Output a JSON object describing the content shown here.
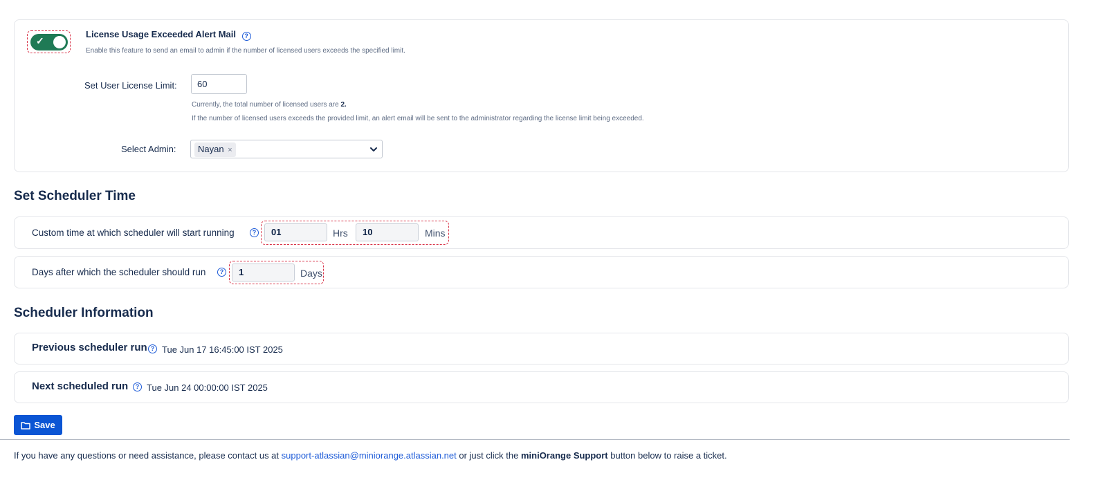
{
  "alert_mail": {
    "title": "License Usage Exceeded Alert Mail",
    "description": "Enable this feature to send an email to admin if the number of licensed users exceeds the specified limit.",
    "enabled": true,
    "limit_label": "Set User License Limit:",
    "limit_value": "60",
    "current_prefix": "Currently, the total number of licensed users are ",
    "current_count": "2.",
    "exceed_note": "If the number of licensed users exceeds the provided limit, an alert email will be sent to the administrator regarding the license limit being exceeded.",
    "admin_label": "Select Admin:",
    "admin_selected": "Nayan"
  },
  "scheduler_time": {
    "heading": "Set Scheduler Time",
    "custom_label": "Custom time at which scheduler will start running",
    "hours_value": "01",
    "hours_unit": "Hrs",
    "mins_value": "10",
    "mins_unit": "Mins",
    "days_label": "Days after which the scheduler should run",
    "days_value": "1",
    "days_unit": "Days"
  },
  "scheduler_info": {
    "heading": "Scheduler Information",
    "previous_label": "Previous scheduler run",
    "previous_value": "Tue Jun 17 16:45:00 IST 2025",
    "next_label": "Next scheduled run",
    "next_value": "Tue Jun 24 00:00:00 IST 2025"
  },
  "save_label": "Save",
  "footer": {
    "prefix": "If you have any questions or need assistance, please contact us at ",
    "email": "support-atlassian@miniorange.atlassian.net",
    "middle": " or just click the ",
    "strong": "miniOrange Support",
    "suffix": " button below to raise a ticket."
  },
  "icons": {
    "help": "question-circle-icon",
    "check": "check-icon",
    "remove": "remove-tag-icon",
    "chevron": "chevron-down-icon",
    "folder": "folder-icon"
  },
  "colors": {
    "toggle_on": "#1f7a55",
    "primary": "#0b55d4",
    "link": "#1d5bd8",
    "highlight": "#d9354a"
  }
}
